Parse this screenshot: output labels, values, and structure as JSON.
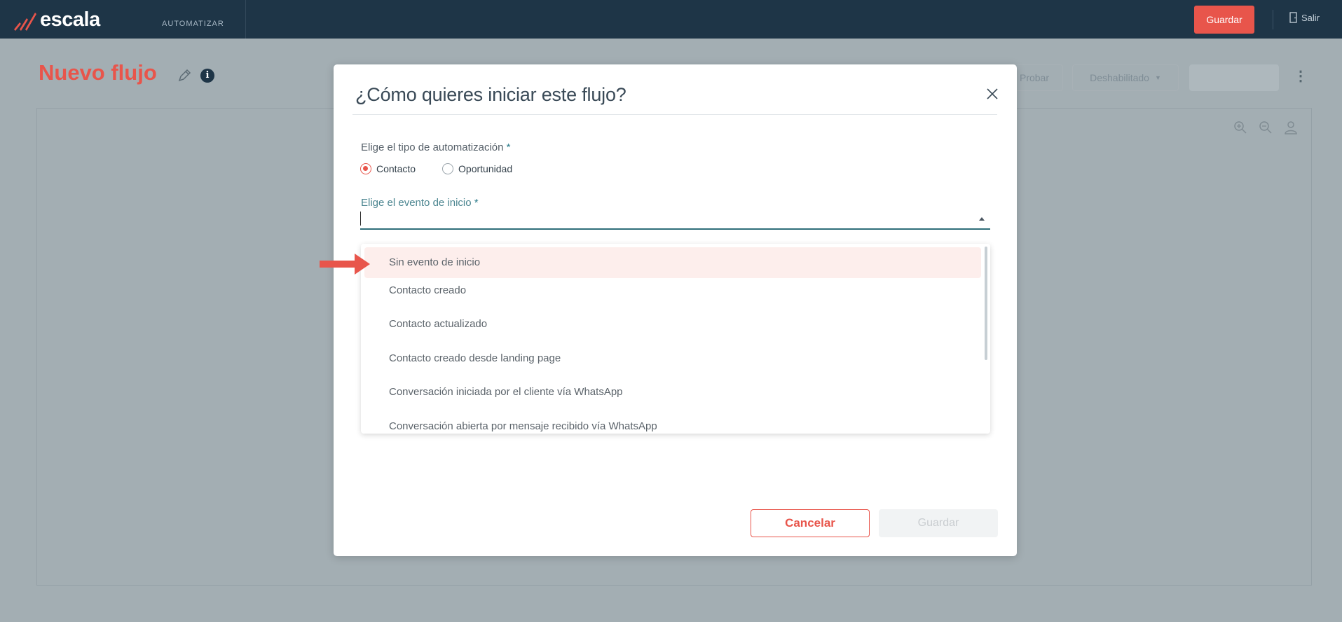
{
  "app": {
    "brand": "escala",
    "nav_label": "AUTOMATIZAR",
    "save_label": "Guardar",
    "exit_label": "Salir"
  },
  "page": {
    "title": "Nuevo flujo",
    "toolbar": {
      "probar_label": "Probar",
      "status_label": "Deshabilitado"
    }
  },
  "modal": {
    "title": "¿Cómo quieres iniciar este flujo?",
    "type_label": "Elige el tipo de automatización",
    "required_mark": "*",
    "radio_options": [
      {
        "label": "Contacto",
        "checked": true
      },
      {
        "label": "Oportunidad",
        "checked": false
      }
    ],
    "event_label": "Elige el evento de inicio",
    "event_options": [
      "Sin evento de inicio",
      "Contacto creado",
      "Contacto actualizado",
      "Contacto creado desde landing page",
      "Conversación iniciada por el cliente vía WhatsApp",
      "Conversación abierta por mensaje recibido vía WhatsApp"
    ],
    "highlighted_option_index": 0,
    "cancel_label": "Cancelar",
    "save_label": "Guardar"
  },
  "colors": {
    "accent": "#e8554b",
    "topbar": "#1e3547",
    "teal": "#2f6e7a",
    "overlay": "#a3aeb3"
  }
}
